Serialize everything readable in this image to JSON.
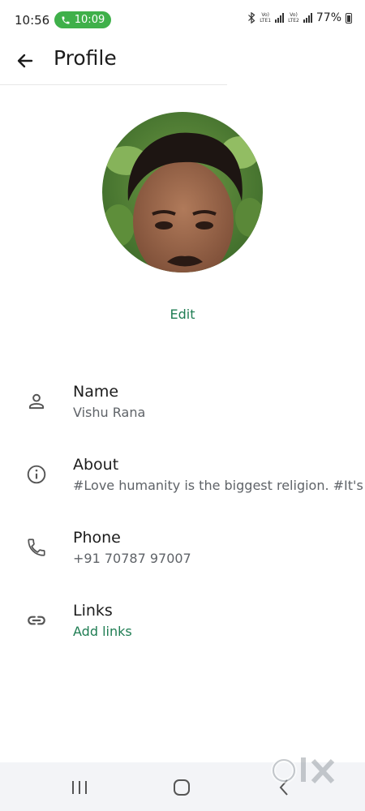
{
  "status_bar": {
    "time": "10:56",
    "call_timer": "10:09",
    "sim1": "LTE1",
    "sim2": "LTE2",
    "battery": "77%"
  },
  "app_bar": {
    "title": "Profile"
  },
  "avatar": {
    "edit_label": "Edit"
  },
  "rows": [
    {
      "icon": "person-icon",
      "label": "Name",
      "value": "Vishu Rana"
    },
    {
      "icon": "info-icon",
      "label": "About",
      "value": "#Love humanity is the biggest religion. #It's rea"
    },
    {
      "icon": "phone-icon",
      "label": "Phone",
      "value": "+91 70787 97007"
    },
    {
      "icon": "link-icon",
      "label": "Links",
      "value": "Add links"
    }
  ],
  "watermark": "olx",
  "colors": {
    "accent": "#1f7d53",
    "call_pill": "#3fb04a",
    "nav_bg": "#f3f4f7"
  }
}
